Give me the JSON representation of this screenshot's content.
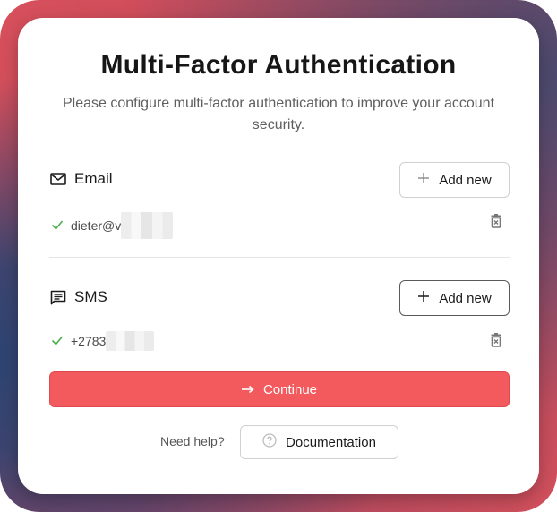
{
  "dialog": {
    "title": "Multi-Factor Authentication",
    "subtitle": "Please configure multi-factor authentication to improve your account security."
  },
  "email_section": {
    "label": "Email",
    "add_label": "Add new",
    "entries": [
      {
        "value": "dieter@v",
        "verified": true
      }
    ]
  },
  "sms_section": {
    "label": "SMS",
    "add_label": "Add new",
    "entries": [
      {
        "value": "+2783",
        "verified": true
      }
    ]
  },
  "continue_label": "Continue",
  "help": {
    "text": "Need help?",
    "doc_label": "Documentation"
  },
  "colors": {
    "accent": "#f35a5d",
    "check": "#4caf50"
  },
  "icons": {
    "email": "envelope-icon",
    "sms": "message-icon",
    "add": "plus-icon",
    "verified": "check-icon",
    "delete": "trash-icon",
    "continue": "arrow-right-icon",
    "help": "question-circle-icon"
  }
}
